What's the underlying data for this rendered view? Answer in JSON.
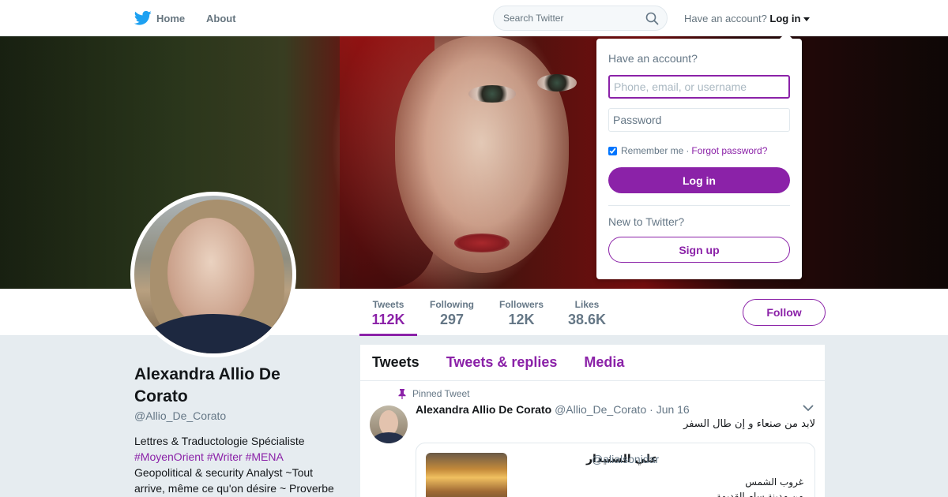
{
  "nav": {
    "home_label": "Home",
    "about_label": "About",
    "search_placeholder": "Search Twitter",
    "have_account_prefix": "Have an account?",
    "login_label": "Log in"
  },
  "profile": {
    "name": "Alexandra Allio De Corato",
    "handle": "@Allio_De_Corato",
    "bio_line1": "Lettres & Traductologie Spécialiste",
    "bio_hashtags": [
      "#MoyenOrient",
      "#Writer",
      "#MENA"
    ],
    "bio_line3": "Geopolitical & security Analyst ~Tout arrive, même ce qu'on désire ~ Proverbe"
  },
  "stats": [
    {
      "label": "Tweets",
      "value": "112K",
      "active": true
    },
    {
      "label": "Following",
      "value": "297",
      "active": false
    },
    {
      "label": "Followers",
      "value": "12K",
      "active": false
    },
    {
      "label": "Likes",
      "value": "38.6K",
      "active": false
    }
  ],
  "follow_label": "Follow",
  "timeline": {
    "tabs": [
      "Tweets",
      "Tweets & replies",
      "Media"
    ],
    "active_tab": 0,
    "pinned": {
      "pinned_label": "Pinned Tweet",
      "author_name": "Alexandra Allio De Corato",
      "author_handle": "@Allio_De_Corato",
      "date": "Jun 16",
      "text": "لابد من صنعاء و إن طال السفر",
      "quote": {
        "name": "علي السنيدار",
        "handle": "@alialsonidar",
        "line1": "غروب الشمس",
        "line2": "من مدينة سام القديمة"
      }
    }
  },
  "login_dropdown": {
    "title": "Have an account?",
    "username_placeholder": "Phone, email, or username",
    "password_placeholder": "Password",
    "remember_label": "Remember me",
    "separator": "·",
    "forgot_label": "Forgot password?",
    "login_button": "Log in",
    "new_prompt": "New to Twitter?",
    "signup_button": "Sign up"
  },
  "colors": {
    "accent": "#8b22a8",
    "brand_blue": "#1da1f2",
    "muted_text": "#657786"
  }
}
